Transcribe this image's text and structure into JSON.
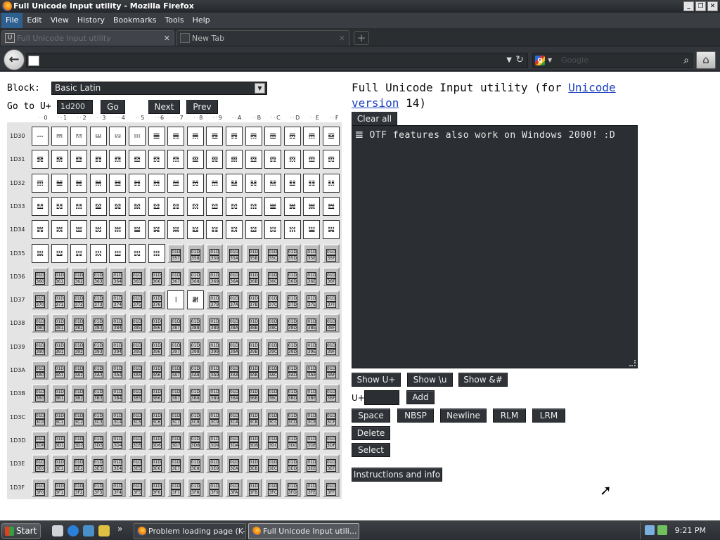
{
  "window": {
    "title": "Full Unicode Input utility - Mozilla Firefox"
  },
  "menu": [
    "File",
    "Edit",
    "View",
    "History",
    "Bookmarks",
    "Tools",
    "Help"
  ],
  "tabs": [
    {
      "label": "Full Unicode Input utility",
      "icon": "U"
    },
    {
      "label": "New Tab",
      "icon": ""
    }
  ],
  "nav": {
    "url_text": "",
    "search_placeholder": "Google"
  },
  "page": {
    "block_label": "Block:",
    "block_value": "Basic Latin",
    "goto_label": "Go to U+",
    "goto_value": "1d200",
    "go_button": "Go",
    "next_button": "Next",
    "prev_button": "Prev",
    "column_headers": [
      "0",
      "1",
      "2",
      "3",
      "4",
      "5",
      "6",
      "7",
      "8",
      "9",
      "A",
      "B",
      "C",
      "D",
      "E",
      "F"
    ],
    "row_labels": [
      "1D30",
      "1D31",
      "1D32",
      "1D33",
      "1D34",
      "1D35",
      "1D36",
      "1D37",
      "1D38",
      "1D39",
      "1D3A",
      "1D3B",
      "1D3C",
      "1D3D",
      "1D3E",
      "1D3F"
    ],
    "title_prefix": "Full Unicode Input utility (for ",
    "title_link": "Unicode version",
    "title_suffix": " 14)",
    "clear_all": "Clear all",
    "textarea_content": "𝌆 OTF features also work on Windows 2000! :D",
    "show_uplus": "Show U+",
    "show_u": "Show \\u",
    "show_amp": "Show &#",
    "uplus_label": "U+",
    "add_button": "Add",
    "space_button": "Space",
    "nbsp_button": "NBSP",
    "newline_button": "Newline",
    "rlm_button": "RLM",
    "lrm_button": "LRM",
    "delete_button": "Delete",
    "select_button": "Select",
    "instructions_button": "Instructions and info"
  },
  "taskbar": {
    "start": "Start",
    "tasks": [
      "Problem loading page (K-...",
      "Full Unicode Input utili..."
    ],
    "clock": "9:21 PM",
    "overflow": "»"
  }
}
